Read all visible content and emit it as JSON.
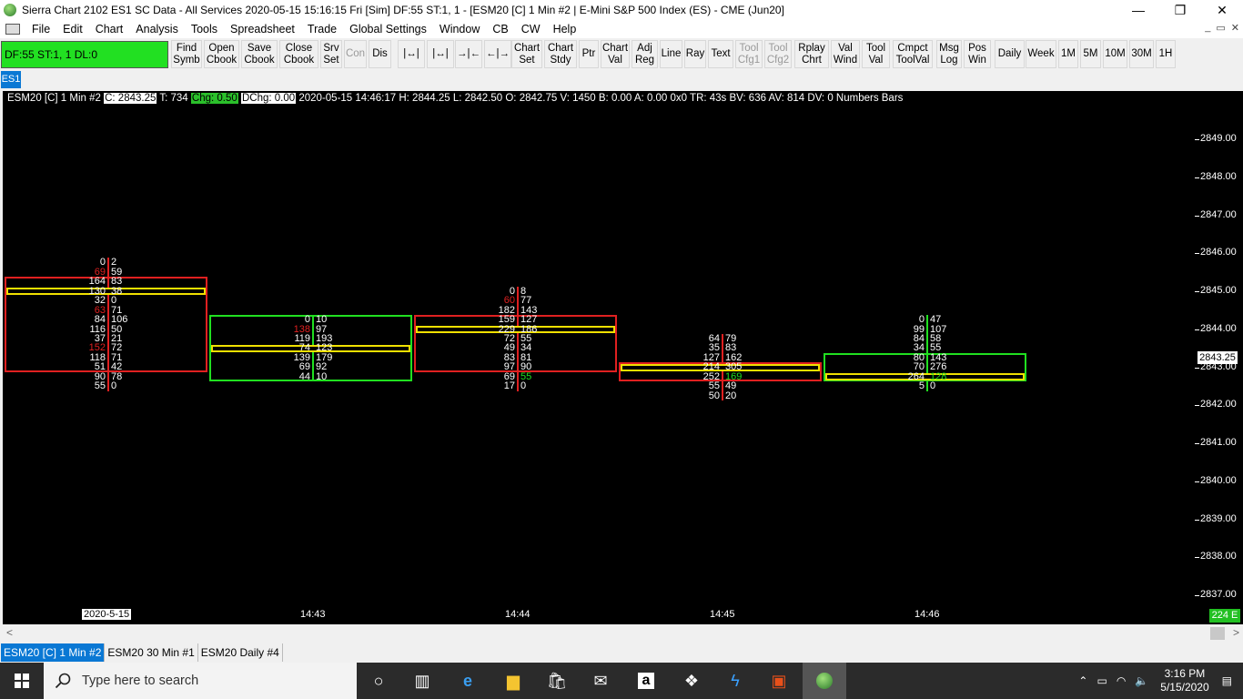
{
  "window": {
    "title": "Sierra Chart 2102 ES1  SC Data - All Services 2020-05-15  15:16:15 Fri [Sim]  DF:55  ST:1, 1  - [ESM20 [C]  1 Min   #2 | E-Mini S&P 500 Index (ES) - CME (Jun20]",
    "minimize": "—",
    "restore": "❐",
    "close": "✕"
  },
  "menu": {
    "items": [
      "File",
      "Edit",
      "Chart",
      "Analysis",
      "Tools",
      "Spreadsheet",
      "Trade",
      "Global Settings",
      "Window",
      "CB",
      "CW",
      "Help"
    ],
    "mdi_buttons": [
      "_",
      "▭",
      "✕"
    ]
  },
  "toolbar": {
    "status_box": "DF:55  ST:1, 1  DL:0",
    "buttons": [
      {
        "l1": "Find",
        "l2": "Symb"
      },
      {
        "l1": "Open",
        "l2": "Cbook"
      },
      {
        "l1": "Save",
        "l2": "Cbook"
      },
      {
        "l1": "Close",
        "l2": "Cbook"
      },
      {
        "l1": "Srv",
        "l2": "Set"
      },
      {
        "l1": "Con",
        "l2": ""
      },
      {
        "l1": "Dis",
        "l2": ""
      },
      {
        "l1": "|↔|",
        "l2": ""
      },
      {
        "l1": "|↔|",
        "l2": ""
      },
      {
        "l1": "→|←",
        "l2": ""
      },
      {
        "l1": "←|→",
        "l2": ""
      },
      {
        "l1": "Chart",
        "l2": "Set"
      },
      {
        "l1": "Chart",
        "l2": "Stdy"
      },
      {
        "l1": "Ptr",
        "l2": ""
      },
      {
        "l1": "Chart",
        "l2": "Val"
      },
      {
        "l1": "Adj",
        "l2": "Reg"
      },
      {
        "l1": "Line",
        "l2": ""
      },
      {
        "l1": "Ray",
        "l2": ""
      },
      {
        "l1": "Text",
        "l2": ""
      },
      {
        "l1": "Tool",
        "l2": "Cfg1"
      },
      {
        "l1": "Tool",
        "l2": "Cfg2"
      },
      {
        "l1": "Rplay",
        "l2": "Chrt"
      },
      {
        "l1": "Val",
        "l2": "Wind"
      },
      {
        "l1": "Tool",
        "l2": "Val"
      },
      {
        "l1": "Cmpct",
        "l2": "ToolVal"
      },
      {
        "l1": "Msg",
        "l2": "Log"
      },
      {
        "l1": "Pos",
        "l2": "Win"
      },
      {
        "l1": "Daily",
        "l2": ""
      },
      {
        "l1": "Week",
        "l2": ""
      },
      {
        "l1": "1M",
        "l2": ""
      },
      {
        "l1": "5M",
        "l2": ""
      },
      {
        "l1": "10M",
        "l2": ""
      },
      {
        "l1": "30M",
        "l2": ""
      },
      {
        "l1": "1H",
        "l2": ""
      }
    ]
  },
  "chartbook_tab": "ES1",
  "chart": {
    "info": {
      "symbol": "ESM20 [C]  1 Min   #2",
      "close": "C: 2843.25",
      "trades": "T: 734",
      "change": "Chg: 0.50",
      "dchange": "DChg: 0.00",
      "details": "2020-05-15 14:46:17  H: 2844.25  L: 2842.50  O: 2842.75  V: 1450  B: 0.00  A: 0.00  0x0  TR: 43s  BV: 636  AV: 814  DV: 0  Numbers Bars"
    },
    "last_price_label": "2843.25",
    "x_labels": [
      "2020-5-15",
      "14:43",
      "14:44",
      "14:45",
      "14:46"
    ],
    "right_badge": "224 E",
    "colors": {
      "up": "#20e020",
      "down": "#e02020",
      "poc": "#f0e000",
      "background": "#000000"
    }
  },
  "chart_data": {
    "type": "footprint",
    "y_axis": {
      "min": 2837.0,
      "max": 2849.0,
      "ticks": [
        "2849.00",
        "2848.00",
        "2847.00",
        "2846.00",
        "2845.00",
        "2844.00",
        "2843.00",
        "2842.00",
        "2841.00",
        "2840.00",
        "2839.00",
        "2838.00",
        "2837.00"
      ]
    },
    "bars": [
      {
        "time": "2020-5-15",
        "direction": "down",
        "open": 2845.25,
        "close": 2843.0,
        "poc": 2845.0,
        "rows": [
          {
            "price": 2845.75,
            "bid": "0",
            "ask": "2"
          },
          {
            "price": 2845.5,
            "bid": "69",
            "ask": "59",
            "bid_color": "red"
          },
          {
            "price": 2845.25,
            "bid": "164",
            "ask": "83"
          },
          {
            "price": 2845.0,
            "bid": "130",
            "ask": "38"
          },
          {
            "price": 2844.75,
            "bid": "32",
            "ask": "0"
          },
          {
            "price": 2844.5,
            "bid": "63",
            "ask": "71",
            "bid_color": "red"
          },
          {
            "price": 2844.25,
            "bid": "84",
            "ask": "106"
          },
          {
            "price": 2844.0,
            "bid": "116",
            "ask": "50"
          },
          {
            "price": 2843.75,
            "bid": "37",
            "ask": "21"
          },
          {
            "price": 2843.5,
            "bid": "152",
            "ask": "72",
            "bid_color": "red"
          },
          {
            "price": 2843.25,
            "bid": "118",
            "ask": "71"
          },
          {
            "price": 2843.0,
            "bid": "51",
            "ask": "42"
          },
          {
            "price": 2842.75,
            "bid": "90",
            "ask": "78"
          },
          {
            "price": 2842.5,
            "bid": "55",
            "ask": "0"
          }
        ]
      },
      {
        "time": "14:43",
        "direction": "up",
        "open": 2842.75,
        "close": 2844.25,
        "poc": 2843.5,
        "rows": [
          {
            "price": 2844.25,
            "bid": "0",
            "ask": "10"
          },
          {
            "price": 2844.0,
            "bid": "138",
            "ask": "97",
            "bid_color": "red"
          },
          {
            "price": 2843.75,
            "bid": "119",
            "ask": "193"
          },
          {
            "price": 2843.5,
            "bid": "74",
            "ask": "123"
          },
          {
            "price": 2843.25,
            "bid": "139",
            "ask": "179"
          },
          {
            "price": 2843.0,
            "bid": "69",
            "ask": "92"
          },
          {
            "price": 2842.75,
            "bid": "44",
            "ask": "10"
          }
        ]
      },
      {
        "time": "14:44",
        "direction": "down",
        "open": 2844.25,
        "close": 2843.0,
        "poc": 2844.0,
        "rows": [
          {
            "price": 2845.0,
            "bid": "0",
            "ask": "8"
          },
          {
            "price": 2844.75,
            "bid": "60",
            "ask": "77",
            "bid_color": "red"
          },
          {
            "price": 2844.5,
            "bid": "182",
            "ask": "143"
          },
          {
            "price": 2844.25,
            "bid": "159",
            "ask": "127"
          },
          {
            "price": 2844.0,
            "bid": "229",
            "ask": "186"
          },
          {
            "price": 2843.75,
            "bid": "72",
            "ask": "55"
          },
          {
            "price": 2843.5,
            "bid": "49",
            "ask": "34"
          },
          {
            "price": 2843.25,
            "bid": "83",
            "ask": "81"
          },
          {
            "price": 2843.0,
            "bid": "97",
            "ask": "90"
          },
          {
            "price": 2842.75,
            "bid": "69",
            "ask": "55",
            "ask_color": "green"
          },
          {
            "price": 2842.5,
            "bid": "17",
            "ask": "0"
          }
        ]
      },
      {
        "time": "14:45",
        "direction": "down",
        "open": 2843.0,
        "close": 2842.75,
        "poc": 2843.0,
        "rows": [
          {
            "price": 2843.75,
            "bid": "64",
            "ask": "79"
          },
          {
            "price": 2843.5,
            "bid": "35",
            "ask": "83"
          },
          {
            "price": 2843.25,
            "bid": "127",
            "ask": "162"
          },
          {
            "price": 2843.0,
            "bid": "214",
            "ask": "305"
          },
          {
            "price": 2842.75,
            "bid": "252",
            "ask": "169",
            "ask_color": "green"
          },
          {
            "price": 2842.5,
            "bid": "55",
            "ask": "49"
          },
          {
            "price": 2842.25,
            "bid": "50",
            "ask": "20"
          }
        ]
      },
      {
        "time": "14:46",
        "direction": "up",
        "open": 2842.75,
        "close": 2843.25,
        "poc": 2842.75,
        "rows": [
          {
            "price": 2844.25,
            "bid": "0",
            "ask": "47"
          },
          {
            "price": 2844.0,
            "bid": "99",
            "ask": "107"
          },
          {
            "price": 2843.75,
            "bid": "84",
            "ask": "58"
          },
          {
            "price": 2843.5,
            "bid": "34",
            "ask": "55"
          },
          {
            "price": 2843.25,
            "bid": "80",
            "ask": "143"
          },
          {
            "price": 2843.0,
            "bid": "70",
            "ask": "276"
          },
          {
            "price": 2842.75,
            "bid": "264",
            "ask": "128",
            "ask_color": "green"
          },
          {
            "price": 2842.5,
            "bid": "5",
            "ask": "0"
          }
        ]
      }
    ]
  },
  "sheet_tabs": [
    {
      "label": "ESM20 [C]  1 Min   #2",
      "active": true
    },
    {
      "label": "ESM20  30 Min   #1",
      "active": false
    },
    {
      "label": "ESM20  Daily  #4",
      "active": false
    }
  ],
  "taskbar": {
    "search_placeholder": "Type here to search",
    "icons": [
      "task-view-icon",
      "edge-icon",
      "file-explorer-icon",
      "store-icon",
      "mail-icon",
      "amazon-icon",
      "dropbox-icon",
      "sierra-icon",
      "office-icon",
      "sierra-chart-app-icon"
    ],
    "time": "3:16 PM",
    "date": "5/15/2020"
  }
}
